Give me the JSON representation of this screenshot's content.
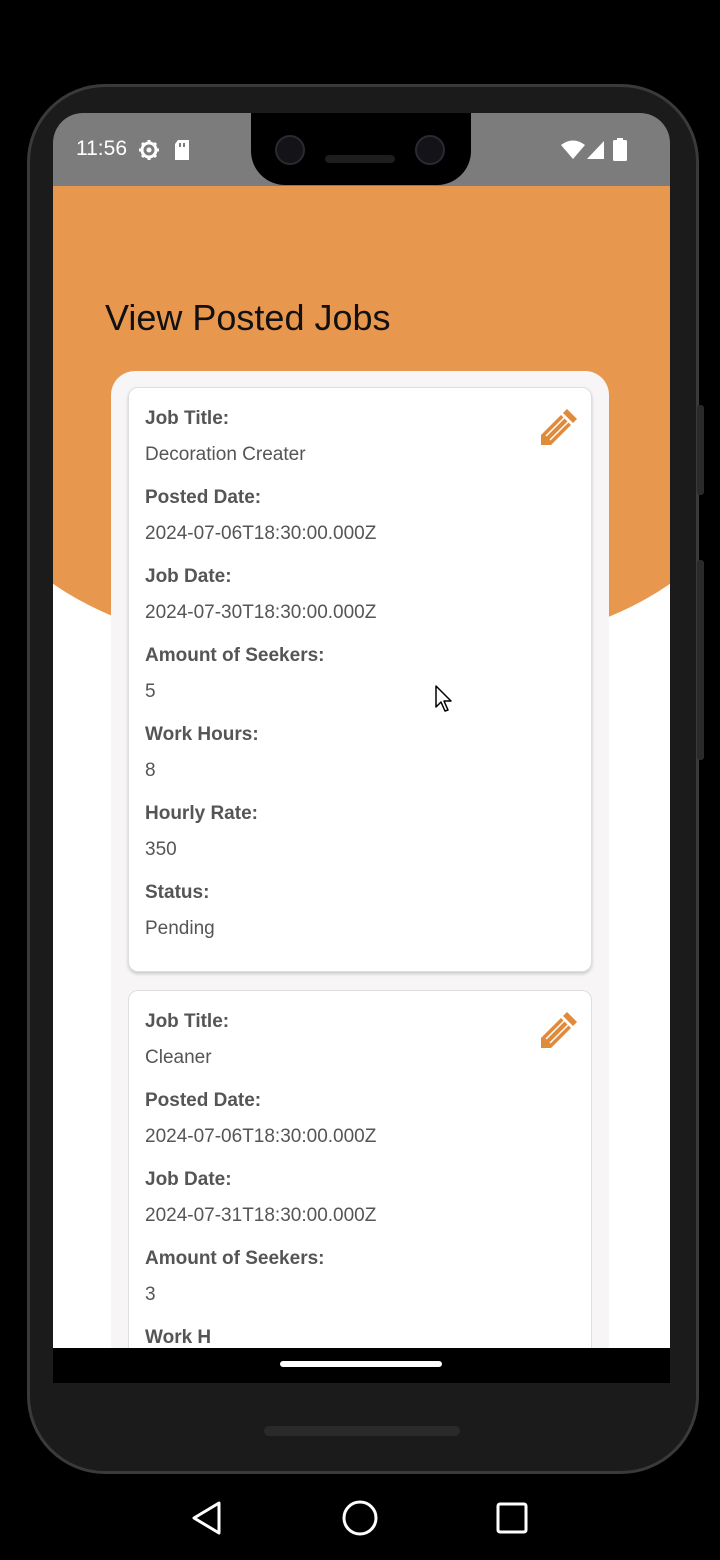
{
  "status_bar": {
    "time": "11:56",
    "left_icons": [
      "settings-gear-icon",
      "sd-card-icon"
    ],
    "right_icons": [
      "wifi-icon",
      "signal-icon",
      "battery-icon"
    ]
  },
  "page": {
    "title": "View Posted Jobs"
  },
  "colors": {
    "accent": "#e8974f",
    "edit_icon": "#e08a3c"
  },
  "jobs": [
    {
      "job_title_label": "Job Title:",
      "job_title": "Decoration Creater",
      "posted_date_label": "Posted Date:",
      "posted_date": "2024-07-06T18:30:00.000Z",
      "job_date_label": "Job Date:",
      "job_date": "2024-07-30T18:30:00.000Z",
      "seekers_label": "Amount of Seekers:",
      "seekers": "5",
      "hours_label": "Work Hours:",
      "hours": "8",
      "rate_label": "Hourly Rate:",
      "rate": "350",
      "status_label": "Status:",
      "status": "Pending",
      "edit_icon": "pencil-icon"
    },
    {
      "job_title_label": "Job Title:",
      "job_title": "Cleaner",
      "posted_date_label": "Posted Date:",
      "posted_date": "2024-07-06T18:30:00.000Z",
      "job_date_label": "Job Date:",
      "job_date": "2024-07-31T18:30:00.000Z",
      "seekers_label": "Amount of Seekers:",
      "seekers": "3",
      "hours_label": "Work H",
      "edit_icon": "pencil-icon"
    }
  ],
  "nav_bar": {
    "buttons": [
      "back-icon",
      "home-icon",
      "recents-icon"
    ]
  }
}
